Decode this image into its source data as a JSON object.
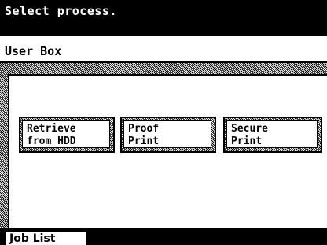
{
  "screen": {
    "prompt": "Select process.",
    "title": "User Box"
  },
  "processes": [
    {
      "label": "Retrieve\nfrom HDD"
    },
    {
      "label": "Proof\nPrint"
    },
    {
      "label": "Secure\nPrint"
    }
  ],
  "footer": {
    "job_list_label": "Job List"
  }
}
